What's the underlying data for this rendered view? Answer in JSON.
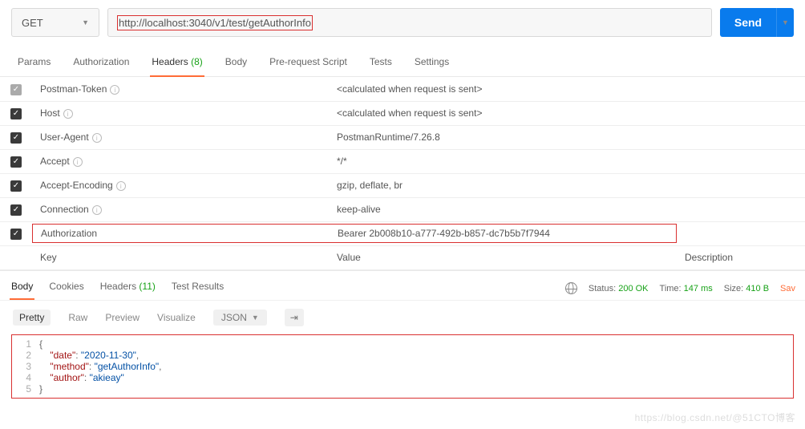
{
  "request": {
    "method": "GET",
    "url": "http://localhost:3040/v1/test/getAuthorInfo",
    "send_label": "Send"
  },
  "tabs": {
    "params": "Params",
    "auth": "Authorization",
    "headers_label": "Headers",
    "headers_count": "(8)",
    "body": "Body",
    "prescript": "Pre-request Script",
    "tests": "Tests",
    "settings": "Settings"
  },
  "headers": [
    {
      "checked": true,
      "disabled": true,
      "key": "Postman-Token",
      "info": true,
      "value": "<calculated when request is sent>"
    },
    {
      "checked": true,
      "key": "Host",
      "info": true,
      "value": "<calculated when request is sent>"
    },
    {
      "checked": true,
      "key": "User-Agent",
      "info": true,
      "value": "PostmanRuntime/7.26.8"
    },
    {
      "checked": true,
      "key": "Accept",
      "info": true,
      "value": "*/*"
    },
    {
      "checked": true,
      "key": "Accept-Encoding",
      "info": true,
      "value": "gzip, deflate, br"
    },
    {
      "checked": true,
      "key": "Connection",
      "info": true,
      "value": "keep-alive"
    },
    {
      "checked": true,
      "key": "Authorization",
      "value": "Bearer 2b008b10-a777-492b-b857-dc7b5b7f7944",
      "boxed": true
    }
  ],
  "placeholder": {
    "key": "Key",
    "value": "Value",
    "desc": "Description"
  },
  "response": {
    "tabs": {
      "body": "Body",
      "cookies": "Cookies",
      "headers": "Headers",
      "headers_count": "(11)",
      "tests": "Test Results"
    },
    "meta": {
      "status_label": "Status:",
      "status": "200 OK",
      "time_label": "Time:",
      "time": "147 ms",
      "size_label": "Size:",
      "size": "410 B",
      "save": "Sav"
    },
    "viewbar": {
      "pretty": "Pretty",
      "raw": "Raw",
      "preview": "Preview",
      "visualize": "Visualize",
      "lang": "JSON"
    },
    "code": {
      "l1": "{",
      "l2k": "\"date\"",
      "l2v": "\"2020-11-30\"",
      "l3k": "\"method\"",
      "l3v": "\"getAuthorInfo\"",
      "l4k": "\"author\"",
      "l4v": "\"akieay\"",
      "l5": "}"
    }
  },
  "watermark": "https://blog.csdn.net/@51CTO博客"
}
